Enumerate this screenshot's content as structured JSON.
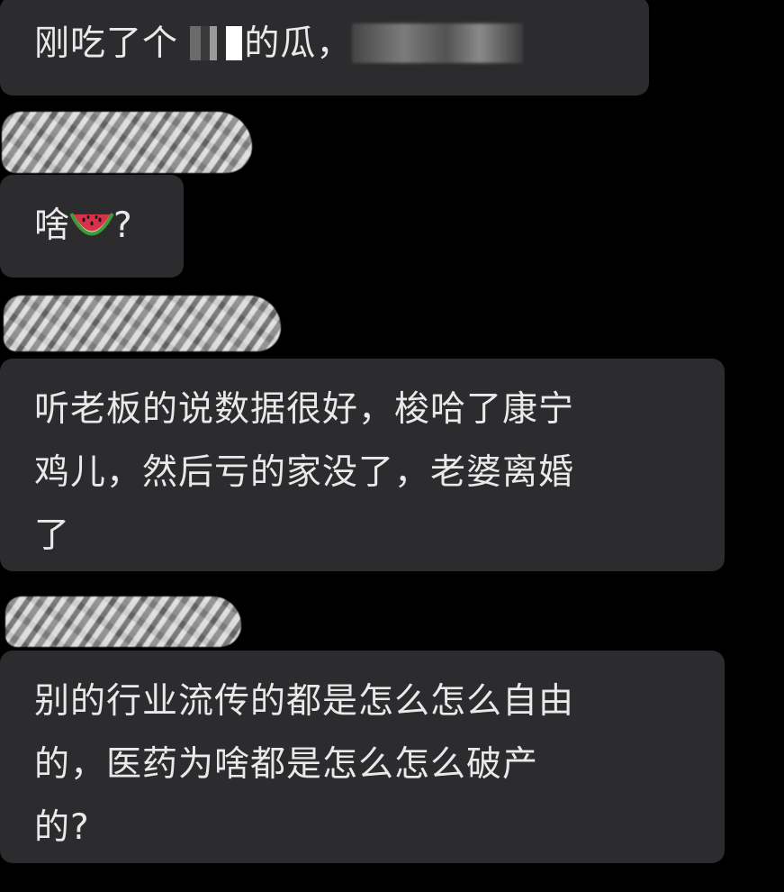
{
  "colors": {
    "background": "#000000",
    "bubble": "#2c2c2e",
    "text": "#e9e9e9"
  },
  "messages": [
    {
      "text_before": "刚吃了个",
      "text_mid": "的瓜，",
      "redacted": true
    },
    {
      "text": "啥",
      "emoji": "watermelon-emoji",
      "suffix": "?"
    },
    {
      "text": "听老板的说数据很好，梭哈了康宁\n鸡儿，然后亏的家没了，老婆离婚\n了"
    },
    {
      "text": "别的行业流传的都是怎么怎么自由\n的，医药为啥都是怎么怎么破产\n的?"
    }
  ]
}
